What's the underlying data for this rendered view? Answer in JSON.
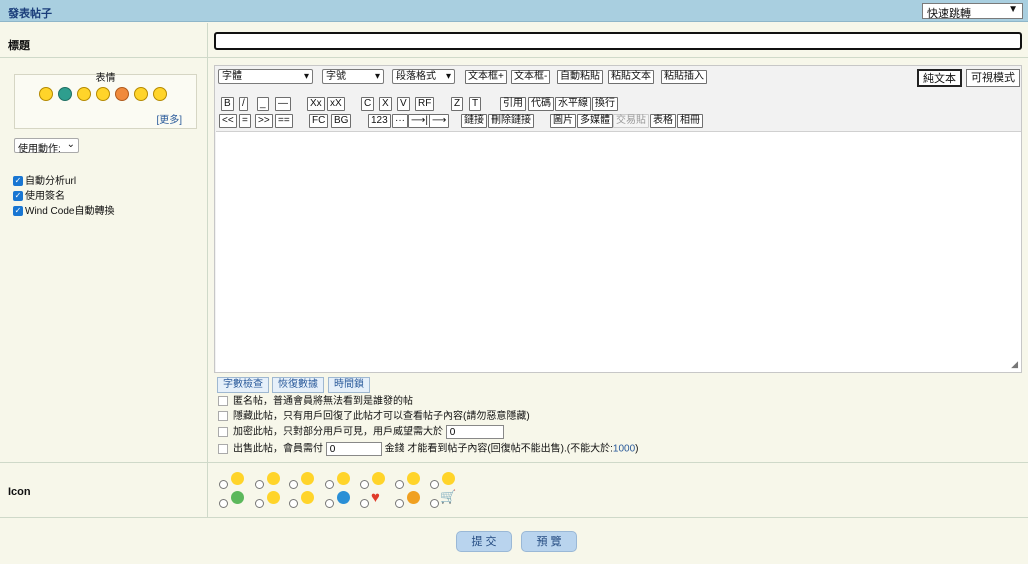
{
  "header": {
    "title": "發表帖子",
    "jump_select": "快速跳轉"
  },
  "form": {
    "title_label": "標題",
    "icon_label": "Icon"
  },
  "sidebar": {
    "emotion_header": "表情",
    "more_link": "[更多]",
    "action_select": "使用動作:",
    "options": [
      "自動分析url",
      "使用簽名",
      "Wind Code自動轉換"
    ]
  },
  "toolbar": {
    "font_select": "字體",
    "size_select": "字號",
    "paragraph_select": "段落格式",
    "row1": [
      "文本框+",
      "文本框-",
      "自動粘貼",
      "粘貼文本",
      "粘貼插入"
    ],
    "row2_a": [
      "B",
      "/",
      "_",
      "—"
    ],
    "row2_b": [
      "Xx",
      "xX"
    ],
    "row2_c": [
      "C",
      "X",
      "V",
      "RF"
    ],
    "row2_d": [
      "Z",
      "T"
    ],
    "row2_e": [
      "引用",
      "代碼",
      "水平線",
      "換行"
    ],
    "row3_a": [
      "<<",
      "=",
      ">>",
      "=="
    ],
    "row3_b": [
      "FC",
      "BG"
    ],
    "row3_c": [
      "123",
      "···",
      "⟶|",
      "⟶"
    ],
    "row3_d": [
      "鏈接",
      "刪除鏈接"
    ],
    "row3_e": [
      "圖片",
      "多媒體",
      "交易貼",
      "表格",
      "相冊"
    ],
    "plain_mode": "純文本",
    "visual_mode": "可視模式"
  },
  "actions": [
    "字數檢查",
    "恢復數據",
    "時間鎖"
  ],
  "post_options": {
    "anonymous": "匿名帖，普通會員將無法看到是誰發的帖",
    "hidden": "隱藏此帖，只有用戶回復了此帖才可以查看帖子內容(請勿惡意隱藏)",
    "encrypt": "加密此帖，只對部分用戶可見，用戶威望需大於",
    "encrypt_value": "0",
    "sell_prefix": "出售此帖，會員需付",
    "sell_value": "0",
    "sell_suffix": "金錢 才能看到帖子內容(回復帖不能出售).(不能大於:",
    "sell_max": "1000",
    "sell_close": ")"
  },
  "buttons": {
    "submit": "提 交",
    "preview": "預 覽"
  },
  "colors": {
    "header_bg": "#a9cfe0",
    "accent": "#1976d2",
    "link": "#2a5a9a"
  }
}
